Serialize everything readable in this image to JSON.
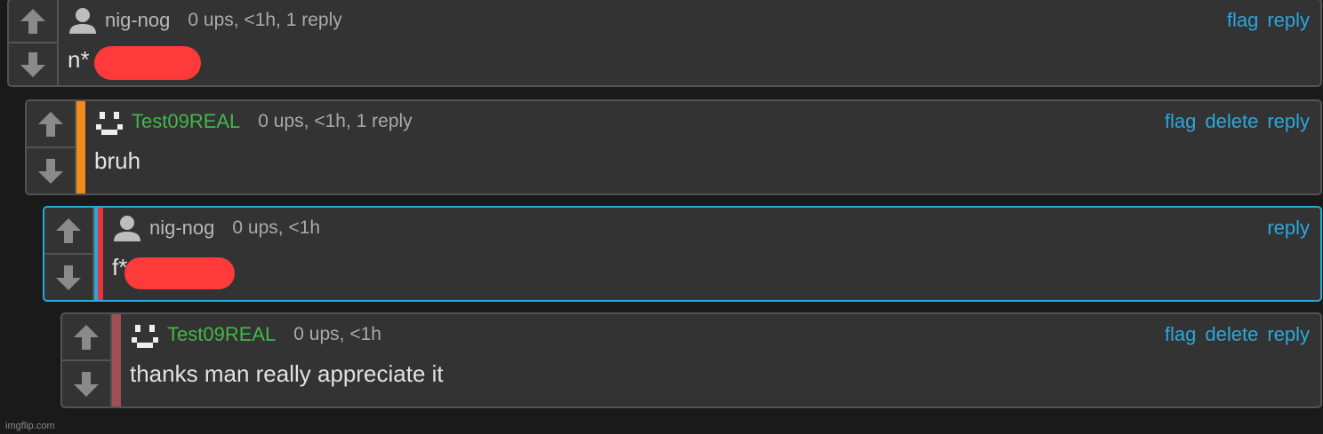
{
  "comments": [
    {
      "username": "nig-nog",
      "meta": "0 ups, <1h, 1 reply",
      "text": "n*",
      "actions": [
        "flag",
        "reply"
      ]
    },
    {
      "username": "Test09REAL",
      "meta": "0 ups, <1h, 1 reply",
      "text": "bruh",
      "actions": [
        "flag",
        "delete",
        "reply"
      ]
    },
    {
      "username": "nig-nog",
      "meta": "0 ups, <1h",
      "text": "f*",
      "actions": [
        "reply"
      ]
    },
    {
      "username": "Test09REAL",
      "meta": "0 ups, <1h",
      "text": "thanks man really appreciate it",
      "actions": [
        "flag",
        "delete",
        "reply"
      ]
    }
  ],
  "colors": {
    "accent": "#2ba7dc",
    "username_green": "#43b64a",
    "redaction": "#ff3a3a",
    "thread_orange": "#f28a1c",
    "thread_red": "#e9343a",
    "thread_maroon": "#a14f52"
  },
  "icons": {
    "upvote": "arrow-up-icon",
    "downvote": "arrow-down-icon",
    "default_avatar": "user-avatar-icon",
    "pixel_avatar": "pixel-face-icon"
  },
  "watermark": "imgflip.com"
}
